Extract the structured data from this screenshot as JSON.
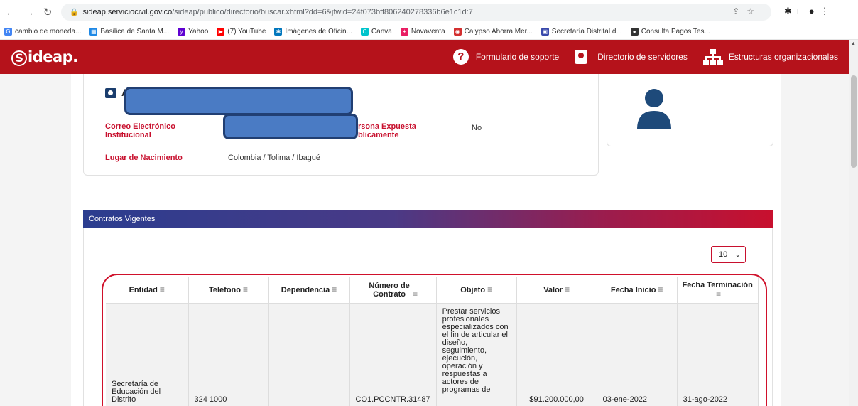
{
  "browser": {
    "url_host": "sideap.serviciocivil.gov.co",
    "url_rest": "/sideap/publico/directorio/buscar.xhtml?dd=6&jfwid=24f073bff806240278336b6e1c1d:7",
    "bookmarks": [
      {
        "label": "cambio de moneda...",
        "icon": "google-icon",
        "color": "#4285f4",
        "glyph": "G"
      },
      {
        "label": "Basilica de Santa M...",
        "icon": "grid-icon",
        "color": "#1e88e5",
        "glyph": "▦"
      },
      {
        "label": "Yahoo",
        "icon": "yahoo-icon",
        "color": "#5f01d1",
        "glyph": "y"
      },
      {
        "label": "(7) YouTube",
        "icon": "youtube-icon",
        "color": "#ff0000",
        "glyph": "▶"
      },
      {
        "label": "Imágenes de Oficin...",
        "icon": "star-icon",
        "color": "#0277bd",
        "glyph": "✱"
      },
      {
        "label": "Canva",
        "icon": "canva-icon",
        "color": "#00c4cc",
        "glyph": "C"
      },
      {
        "label": "Novaventa",
        "icon": "novaventa-icon",
        "color": "#e91e63",
        "glyph": "✶"
      },
      {
        "label": "Calypso Ahorra Mer...",
        "icon": "calypso-icon",
        "color": "#d32f2f",
        "glyph": "◉"
      },
      {
        "label": "Secretaría Distrital d...",
        "icon": "shield-icon",
        "color": "#3949ab",
        "glyph": "▣"
      },
      {
        "label": "Consulta Pagos Tes...",
        "icon": "globe-icon",
        "color": "#333333",
        "glyph": "●"
      }
    ]
  },
  "header": {
    "logo": "Sideap.",
    "menu": [
      {
        "label": "Formulario de soporte",
        "icon": "question-icon"
      },
      {
        "label": "Directorio de servidores",
        "icon": "contact-card-icon"
      },
      {
        "label": "Estructuras organizacionales",
        "icon": "org-chart-icon"
      }
    ]
  },
  "profile": {
    "name_initial": "A",
    "fields": {
      "email_label": "Correo Electrónico Institucional",
      "pep_label_visible": "rsona Expuesta blicamente",
      "pep_value": "No",
      "birthplace_label": "Lugar de Nacimiento",
      "birthplace_value": "Colombia / Tolima / Ibagué"
    }
  },
  "contracts": {
    "title": "Contratos Vigentes",
    "page_size": "10",
    "columns": [
      "Entidad",
      "Telefono",
      "Dependencia",
      "Número de Contrato",
      "Objeto",
      "Valor",
      "Fecha Inicio",
      "Fecha Terminación"
    ],
    "rows": [
      {
        "entidad": "Secretaría de Educación del Distrito",
        "telefono": "324 1000",
        "dependencia": "",
        "numero": "CO1.PCCNTR.31487",
        "objeto": "Prestar servicios profesionales especializados con el fin de articular el diseño, seguimiento, ejecución, operación y respuestas a actores de programas de",
        "valor": "$91.200.000,00",
        "fecha_inicio": "03-ene-2022",
        "fecha_fin": "31-ago-2022"
      }
    ]
  }
}
